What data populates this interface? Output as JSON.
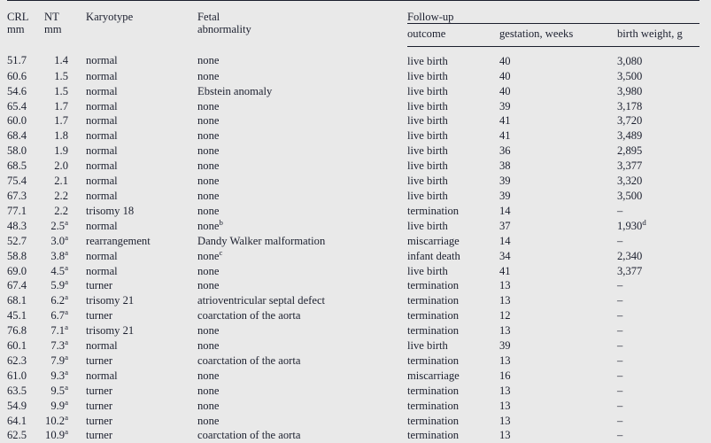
{
  "table": {
    "columns": [
      {
        "key": "crl",
        "line1": "CRL",
        "line2": "mm"
      },
      {
        "key": "nt",
        "line1": "NT",
        "line2": "mm"
      },
      {
        "key": "karyo",
        "line1": "Karyotype",
        "line2": ""
      },
      {
        "key": "fetal",
        "line1": "Fetal",
        "line2": "abnormality"
      }
    ],
    "group_header": "Follow-up",
    "subcolumns": [
      {
        "key": "outcome",
        "label": "outcome"
      },
      {
        "key": "gest",
        "label": "gestation, weeks"
      },
      {
        "key": "weight",
        "label": "birth weight, g"
      }
    ],
    "missing_value": "–",
    "rows": [
      {
        "crl": "51.7",
        "nt": "1.4",
        "nt_sup": "",
        "karyo": "normal",
        "fetal": "none",
        "fetal_sup": "",
        "outcome": "live birth",
        "gest": "40",
        "weight": "3,080",
        "weight_sup": ""
      },
      {
        "crl": "60.6",
        "nt": "1.5",
        "nt_sup": "",
        "karyo": "normal",
        "fetal": "none",
        "fetal_sup": "",
        "outcome": "live birth",
        "gest": "40",
        "weight": "3,500",
        "weight_sup": ""
      },
      {
        "crl": "54.6",
        "nt": "1.5",
        "nt_sup": "",
        "karyo": "normal",
        "fetal": "Ebstein anomaly",
        "fetal_sup": "",
        "outcome": "live birth",
        "gest": "40",
        "weight": "3,980",
        "weight_sup": ""
      },
      {
        "crl": "65.4",
        "nt": "1.7",
        "nt_sup": "",
        "karyo": "normal",
        "fetal": "none",
        "fetal_sup": "",
        "outcome": "live birth",
        "gest": "39",
        "weight": "3,178",
        "weight_sup": ""
      },
      {
        "crl": "60.0",
        "nt": "1.7",
        "nt_sup": "",
        "karyo": "normal",
        "fetal": "none",
        "fetal_sup": "",
        "outcome": "live birth",
        "gest": "41",
        "weight": "3,720",
        "weight_sup": ""
      },
      {
        "crl": "68.4",
        "nt": "1.8",
        "nt_sup": "",
        "karyo": "normal",
        "fetal": "none",
        "fetal_sup": "",
        "outcome": "live birth",
        "gest": "41",
        "weight": "3,489",
        "weight_sup": ""
      },
      {
        "crl": "58.0",
        "nt": "1.9",
        "nt_sup": "",
        "karyo": "normal",
        "fetal": "none",
        "fetal_sup": "",
        "outcome": "live birth",
        "gest": "36",
        "weight": "2,895",
        "weight_sup": ""
      },
      {
        "crl": "68.5",
        "nt": "2.0",
        "nt_sup": "",
        "karyo": "normal",
        "fetal": "none",
        "fetal_sup": "",
        "outcome": "live birth",
        "gest": "38",
        "weight": "3,377",
        "weight_sup": ""
      },
      {
        "crl": "75.4",
        "nt": "2.1",
        "nt_sup": "",
        "karyo": "normal",
        "fetal": "none",
        "fetal_sup": "",
        "outcome": "live birth",
        "gest": "39",
        "weight": "3,320",
        "weight_sup": ""
      },
      {
        "crl": "67.3",
        "nt": "2.2",
        "nt_sup": "",
        "karyo": "normal",
        "fetal": "none",
        "fetal_sup": "",
        "outcome": "live birth",
        "gest": "39",
        "weight": "3,500",
        "weight_sup": ""
      },
      {
        "crl": "77.1",
        "nt": "2.2",
        "nt_sup": "",
        "karyo": "trisomy 18",
        "fetal": "none",
        "fetal_sup": "",
        "outcome": "termination",
        "gest": "14",
        "weight": "–",
        "weight_sup": ""
      },
      {
        "crl": "48.3",
        "nt": "2.5",
        "nt_sup": "a",
        "karyo": "normal",
        "fetal": "none",
        "fetal_sup": "b",
        "outcome": "live birth",
        "gest": "37",
        "weight": "1,930",
        "weight_sup": "d"
      },
      {
        "crl": "52.7",
        "nt": "3.0",
        "nt_sup": "a",
        "karyo": "rearrangement",
        "fetal": "Dandy Walker malformation",
        "fetal_sup": "",
        "outcome": "miscarriage",
        "gest": "14",
        "weight": "–",
        "weight_sup": ""
      },
      {
        "crl": "58.8",
        "nt": "3.8",
        "nt_sup": "a",
        "karyo": "normal",
        "fetal": "none",
        "fetal_sup": "c",
        "outcome": "infant death",
        "gest": "34",
        "weight": "2,340",
        "weight_sup": ""
      },
      {
        "crl": "69.0",
        "nt": "4.5",
        "nt_sup": "a",
        "karyo": "normal",
        "fetal": "none",
        "fetal_sup": "",
        "outcome": "live birth",
        "gest": "41",
        "weight": "3,377",
        "weight_sup": ""
      },
      {
        "crl": "67.4",
        "nt": "5.9",
        "nt_sup": "a",
        "karyo": "turner",
        "fetal": "none",
        "fetal_sup": "",
        "outcome": "termination",
        "gest": "13",
        "weight": "–",
        "weight_sup": ""
      },
      {
        "crl": "68.1",
        "nt": "6.2",
        "nt_sup": "a",
        "karyo": "trisomy 21",
        "fetal": "atrioventricular septal defect",
        "fetal_sup": "",
        "outcome": "termination",
        "gest": "13",
        "weight": "–",
        "weight_sup": ""
      },
      {
        "crl": "45.1",
        "nt": "6.7",
        "nt_sup": "a",
        "karyo": "turner",
        "fetal": "coarctation of the aorta",
        "fetal_sup": "",
        "outcome": "termination",
        "gest": "12",
        "weight": "–",
        "weight_sup": ""
      },
      {
        "crl": "76.8",
        "nt": "7.1",
        "nt_sup": "a",
        "karyo": "trisomy 21",
        "fetal": "none",
        "fetal_sup": "",
        "outcome": "termination",
        "gest": "13",
        "weight": "–",
        "weight_sup": ""
      },
      {
        "crl": "60.1",
        "nt": "7.3",
        "nt_sup": "a",
        "karyo": "normal",
        "fetal": "none",
        "fetal_sup": "",
        "outcome": "live birth",
        "gest": "39",
        "weight": "–",
        "weight_sup": ""
      },
      {
        "crl": "62.3",
        "nt": "7.9",
        "nt_sup": "a",
        "karyo": "turner",
        "fetal": "coarctation of the aorta",
        "fetal_sup": "",
        "outcome": "termination",
        "gest": "13",
        "weight": "–",
        "weight_sup": ""
      },
      {
        "crl": "61.0",
        "nt": "9.3",
        "nt_sup": "a",
        "karyo": "normal",
        "fetal": "none",
        "fetal_sup": "",
        "outcome": "miscarriage",
        "gest": "16",
        "weight": "–",
        "weight_sup": ""
      },
      {
        "crl": "63.5",
        "nt": "9.5",
        "nt_sup": "a",
        "karyo": "turner",
        "fetal": "none",
        "fetal_sup": "",
        "outcome": "termination",
        "gest": "13",
        "weight": "–",
        "weight_sup": ""
      },
      {
        "crl": "54.9",
        "nt": "9.9",
        "nt_sup": "a",
        "karyo": "turner",
        "fetal": "none",
        "fetal_sup": "",
        "outcome": "termination",
        "gest": "13",
        "weight": "–",
        "weight_sup": ""
      },
      {
        "crl": "64.1",
        "nt": "10.2",
        "nt_sup": "a",
        "karyo": "turner",
        "fetal": "none",
        "fetal_sup": "",
        "outcome": "termination",
        "gest": "13",
        "weight": "–",
        "weight_sup": ""
      },
      {
        "crl": "62.5",
        "nt": "10.9",
        "nt_sup": "a",
        "karyo": "turner",
        "fetal": "coarctation of the aorta",
        "fetal_sup": "",
        "outcome": "termination",
        "gest": "13",
        "weight": "–",
        "weight_sup": ""
      }
    ]
  },
  "colors": {
    "page_background": "#e9e9e9",
    "text": "#1b1f2e",
    "rule": "#1b1f2e"
  }
}
